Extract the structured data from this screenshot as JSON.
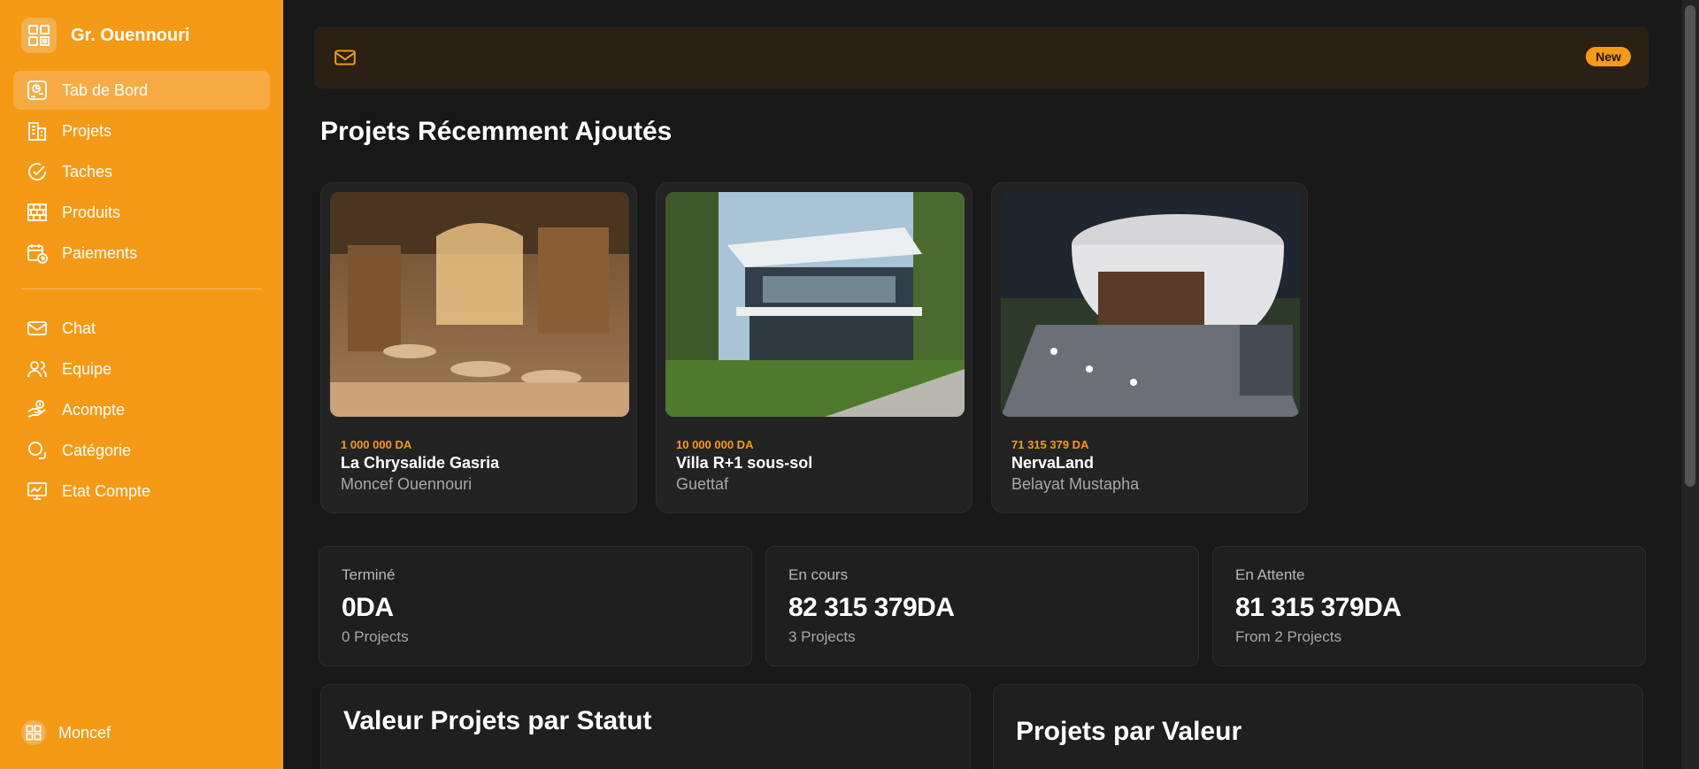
{
  "brand": {
    "name": "Gr. Ouennouri"
  },
  "sidebar": {
    "items": [
      {
        "label": "Tab de Bord",
        "icon": "dashboard-icon",
        "active": true
      },
      {
        "label": "Projets",
        "icon": "building-icon"
      },
      {
        "label": "Taches",
        "icon": "check-circle-icon"
      },
      {
        "label": "Produits",
        "icon": "bricks-icon"
      },
      {
        "label": "Paiements",
        "icon": "calendar-dollar-icon"
      },
      {
        "label": "Chat",
        "icon": "mail-icon"
      },
      {
        "label": "Equipe",
        "icon": "users-icon"
      },
      {
        "label": "Acompte",
        "icon": "money-hand-icon"
      },
      {
        "label": "Catégorie",
        "icon": "category-icon"
      },
      {
        "label": "Etat Compte",
        "icon": "chart-monitor-icon"
      }
    ]
  },
  "user": {
    "name": "Moncef"
  },
  "notice": {
    "badge": "New"
  },
  "recent": {
    "title": "Projets Récemment Ajoutés",
    "projects": [
      {
        "price": "1 000 000 DA",
        "name": "La Chrysalide Gasria",
        "client": "Moncef Ouennouri"
      },
      {
        "price": "10 000 000 DA",
        "name": "Villa R+1 sous-sol",
        "client": "Guettaf"
      },
      {
        "price": "71 315 379 DA",
        "name": "NervaLand",
        "client": "Belayat Mustapha"
      }
    ]
  },
  "stats": [
    {
      "label": "Terminé",
      "value": "0DA",
      "sub": "0 Projects"
    },
    {
      "label": "En cours",
      "value": "82 315 379DA",
      "sub": "3 Projects"
    },
    {
      "label": "En Attente",
      "value": "81 315 379DA",
      "sub": "From 2 Projects"
    }
  ],
  "panels": {
    "left_title": "Valeur Projets par Statut",
    "right_title": "Projets par Valeur"
  },
  "colors": {
    "accent": "#f59a17",
    "background": "#181818",
    "card": "#232323"
  }
}
